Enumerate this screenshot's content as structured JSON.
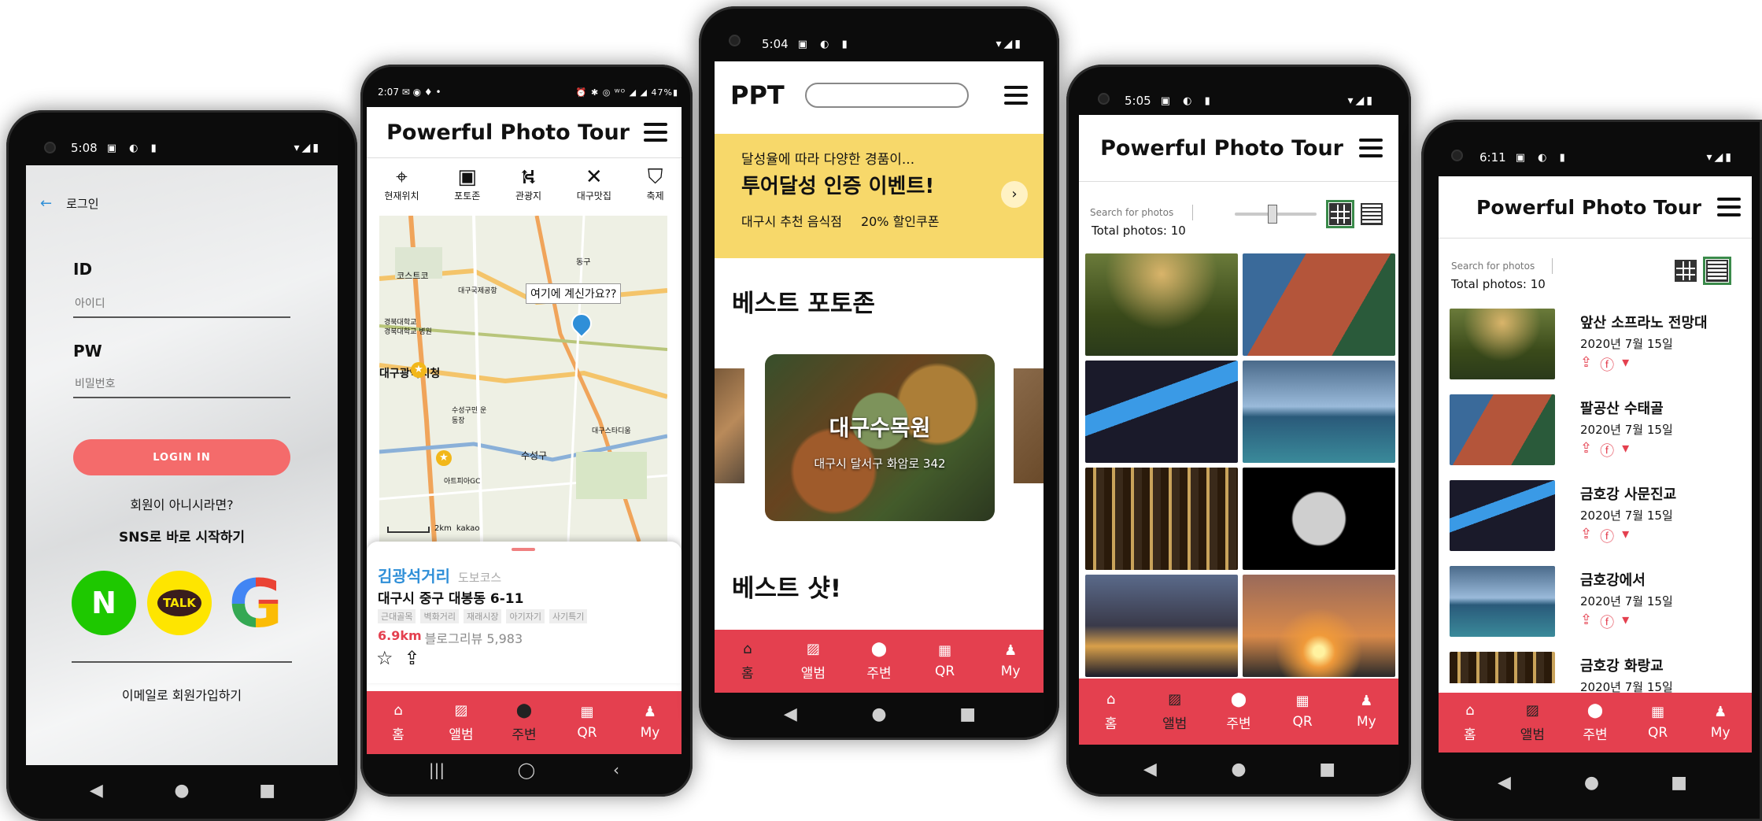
{
  "colors": {
    "accent": "#e4404f",
    "login_button": "#f46b6b",
    "banner": "#f7d86a",
    "link_blue": "#2f8fd8",
    "distance_red": "#e4404f",
    "naver": "#1ec800",
    "kakao": "#fee500"
  },
  "phone1": {
    "status": {
      "time": "5:08",
      "icons": "▣ ◐ ▮",
      "right": "▾◢▮"
    },
    "back_label": "로그인",
    "id_label": "ID",
    "id_placeholder": "아이디",
    "pw_label": "PW",
    "pw_placeholder": "비밀번호",
    "login_button": "LOGIN IN",
    "not_member": "회원이 아니시라면?",
    "sns_start": "SNS로 바로 시작하기",
    "social": {
      "naver": "N",
      "kakao": "TALK",
      "google": "G"
    },
    "email_signup": "이메일로 회원가입하기",
    "nav": [
      "◀",
      "●",
      "■"
    ]
  },
  "phone2": {
    "status": {
      "time": "2:07 ✉ ◉ ♦ •",
      "right": "⏰ ✱ ◎ ᵂᴼ ◢ ◢ 47%▮"
    },
    "title": "Powerful Photo Tour",
    "categories": [
      {
        "icon": "⌖",
        "label": "현재위치"
      },
      {
        "icon": "▣",
        "label": "포토존"
      },
      {
        "icon": "⛕",
        "label": "관광지"
      },
      {
        "icon": "✕",
        "label": "대구맛집"
      },
      {
        "icon": "⛉",
        "label": "축제"
      }
    ],
    "map": {
      "popup": "여기에 계신가요??",
      "labels": [
        "코스트코",
        "경북대학교",
        "대구국제공항",
        "동구",
        "경북대학교 병원",
        "대구광역시청",
        "수성구민 운동장",
        "수성구",
        "대구스타디움",
        "아트피아GC",
        "구"
      ],
      "scale": "2km",
      "provider": "kakao"
    },
    "place": {
      "name": "김광석거리",
      "type": "도보코스",
      "address": "대구시 중구 대봉동 6-11",
      "tags": [
        "근대골목",
        "벽화거리",
        "재래시장",
        "아기자기",
        "사기특기"
      ],
      "distance": "6.9km",
      "blog_reviews": "블로그리뷰 5,983"
    },
    "tabs": [
      {
        "icon": "⌂",
        "label": "홈"
      },
      {
        "icon": "▨",
        "label": "앨범"
      },
      {
        "icon": "⬤",
        "label": "주변"
      },
      {
        "icon": "▦",
        "label": "QR"
      },
      {
        "icon": "♟",
        "label": "My"
      }
    ],
    "nav": [
      "|||",
      "◯",
      "‹"
    ]
  },
  "phone3": {
    "status": {
      "time": "5:04",
      "icons": "▣ ◐ ▮",
      "right": "▾◢▮"
    },
    "logo": "PPT",
    "banner": {
      "line1": "달성율에 따라 다양한 경품이...",
      "title": "투어달성 인증 이벤트!",
      "sub1": "대구시 추천 음식점",
      "sub2": "20% 할인쿠폰"
    },
    "best_photozone": "베스트 포토존",
    "card": {
      "name": "대구수목원",
      "address": "대구시 달서구 화암로 342"
    },
    "best_shot": "베스트 샷!",
    "tabs": [
      {
        "icon": "⌂",
        "label": "홈"
      },
      {
        "icon": "▨",
        "label": "앨범"
      },
      {
        "icon": "⬤",
        "label": "주변"
      },
      {
        "icon": "▦",
        "label": "QR"
      },
      {
        "icon": "♟",
        "label": "My"
      }
    ],
    "nav": [
      "◀",
      "●",
      "■"
    ]
  },
  "phone4": {
    "status": {
      "time": "5:05",
      "icons": "▣ ◐ ▮",
      "right": "▾◢▮"
    },
    "title": "Powerful Photo Tour",
    "search_placeholder": "Search for photos",
    "total": "Total photos: 10",
    "slider_value": 0.45,
    "view_mode": "grid",
    "tabs": [
      {
        "icon": "⌂",
        "label": "홈"
      },
      {
        "icon": "▨",
        "label": "앨범"
      },
      {
        "icon": "⬤",
        "label": "주변"
      },
      {
        "icon": "▦",
        "label": "QR"
      },
      {
        "icon": "♟",
        "label": "My"
      }
    ],
    "nav": [
      "◀",
      "●",
      "■"
    ]
  },
  "phone5": {
    "status": {
      "time": "6:11",
      "icons": "▣ ◐ ▮",
      "right": "▾◢▮"
    },
    "title": "Powerful Photo Tour",
    "search_placeholder": "Search for photos",
    "total": "Total photos: 10",
    "view_mode": "list",
    "items": [
      {
        "name": "앞산 소프라노 전망대",
        "date": "2020년 7월 15일"
      },
      {
        "name": "팔공산 수태골",
        "date": "2020년 7월 15일"
      },
      {
        "name": "금호강 사문진교",
        "date": "2020년 7월 15일"
      },
      {
        "name": "금호강에서",
        "date": "2020년 7월 15일"
      },
      {
        "name": "금호강 화랑교",
        "date": "2020년 7월 15일"
      }
    ],
    "share_icons": [
      "⇪",
      "ⓕ",
      "▾"
    ],
    "tabs": [
      {
        "icon": "⌂",
        "label": "홈"
      },
      {
        "icon": "▨",
        "label": "앨범"
      },
      {
        "icon": "⬤",
        "label": "주변"
      },
      {
        "icon": "▦",
        "label": "QR"
      },
      {
        "icon": "♟",
        "label": "My"
      }
    ],
    "nav": [
      "◀",
      "●",
      "■"
    ]
  }
}
